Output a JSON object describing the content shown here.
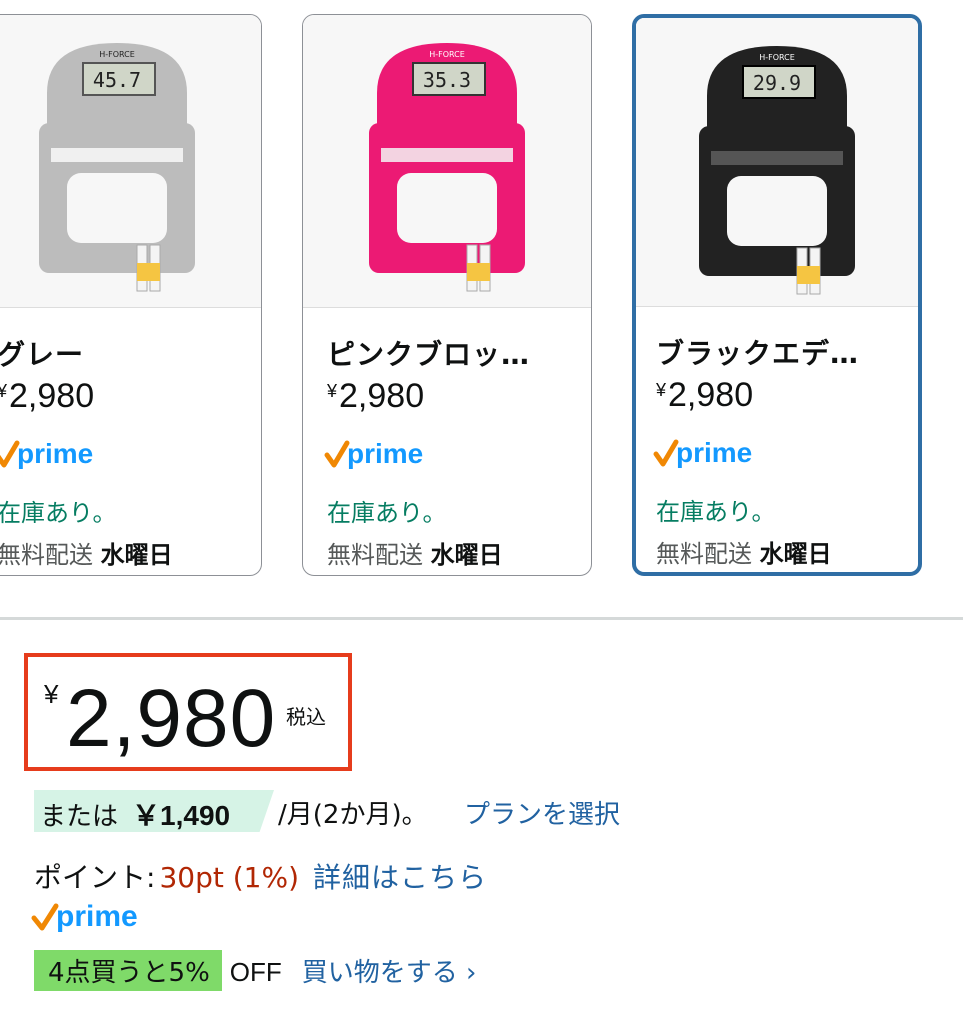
{
  "variations": [
    {
      "name": "グレー",
      "currency": "¥",
      "price": "2,980",
      "prime": "prime",
      "stock": "在庫あり。",
      "shipping": "無料配送",
      "day": "水曜日",
      "selected": false,
      "color": "#bcbcbc",
      "product_label": "H-FORCE",
      "display": "45.7"
    },
    {
      "name": "ピンクブロッ…",
      "currency": "¥",
      "price": "2,980",
      "prime": "prime",
      "stock": "在庫あり。",
      "shipping": "無料配送",
      "day": "水曜日",
      "selected": false,
      "color": "#ec1a74",
      "product_label": "H-FORCE",
      "display": "35.3"
    },
    {
      "name": "ブラックエデ…",
      "currency": "¥",
      "price": "2,980",
      "prime": "prime",
      "stock": "在庫あり。",
      "shipping": "無料配送",
      "day": "水曜日",
      "selected": true,
      "color": "#222222",
      "product_label": "H-FORCE",
      "display": "29.9"
    }
  ],
  "price": {
    "currency": "¥",
    "amount": "2,980",
    "tax": "税込"
  },
  "installment": {
    "prefix": "または",
    "amount": "￥1,490",
    "suffix": "/月(2か月)。",
    "plan_link": "プランを選択"
  },
  "points": {
    "label": "ポイント:",
    "value": "30pt (1%)",
    "link": "詳細はこちら"
  },
  "prime_label": "prime",
  "promo": {
    "tag": "4点買うと5%",
    "off": "OFF",
    "link": "買い物をする ›"
  },
  "colors": {
    "prime_check": "#f08804",
    "prime_text": "#1399ff",
    "link": "#2162a1",
    "stock": "#067d62",
    "price_red": "#b12704",
    "highlight": "#e63c1c"
  }
}
